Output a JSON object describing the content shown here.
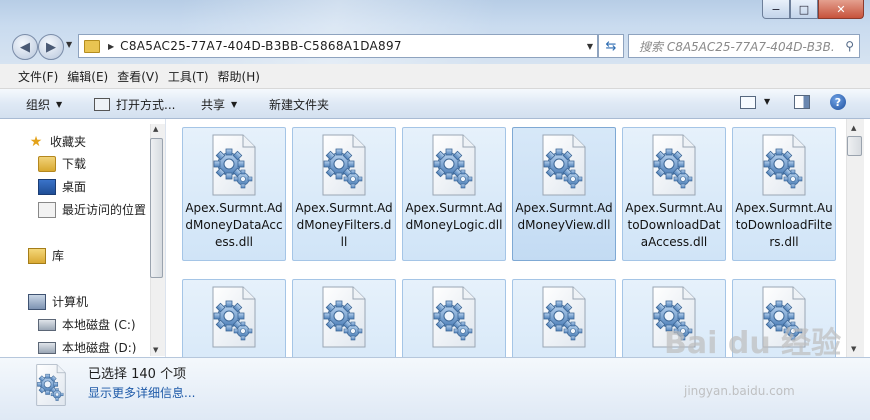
{
  "window": {
    "min_glyph": "−",
    "max_glyph": "□",
    "close_glyph": "✕"
  },
  "nav": {
    "back_glyph": "◀",
    "forward_glyph": "▶"
  },
  "address": {
    "path": "C8A5AC25-77A7-404D-B3BB-C5868A1DA897"
  },
  "search": {
    "placeholder": "搜索 C8A5AC25-77A7-404D-B3B..."
  },
  "menu": [
    "文件(F)",
    "编辑(E)",
    "查看(V)",
    "工具(T)",
    "帮助(H)"
  ],
  "toolbar": {
    "organize": "组织",
    "open_with": "打开方式...",
    "share": "共享",
    "new_folder": "新建文件夹",
    "help_glyph": "?"
  },
  "sidebar": {
    "favorites": "收藏夹",
    "downloads": "下载",
    "desktop": "桌面",
    "recent": "最近访问的位置",
    "libraries": "库",
    "computer": "计算机",
    "disk_c": "本地磁盘 (C:)",
    "disk_d": "本地磁盘 (D:)"
  },
  "files": [
    "Apex.Surmnt.AddMoneyDataAccess.dll",
    "Apex.Surmnt.AddMoneyFilters.dll",
    "Apex.Surmnt.AddMoneyLogic.dll",
    "Apex.Surmnt.AddMoneyView.dll",
    "Apex.Surmnt.AutoDownloadDataAccess.dll",
    "Apex.Surmnt.AutoDownloadFilters.dll"
  ],
  "details": {
    "selected": "已选择 140 个项",
    "more": "显示更多详细信息..."
  },
  "watermark": {
    "brand": "Bai du 经验",
    "url": "jingyan.baidu.com"
  }
}
